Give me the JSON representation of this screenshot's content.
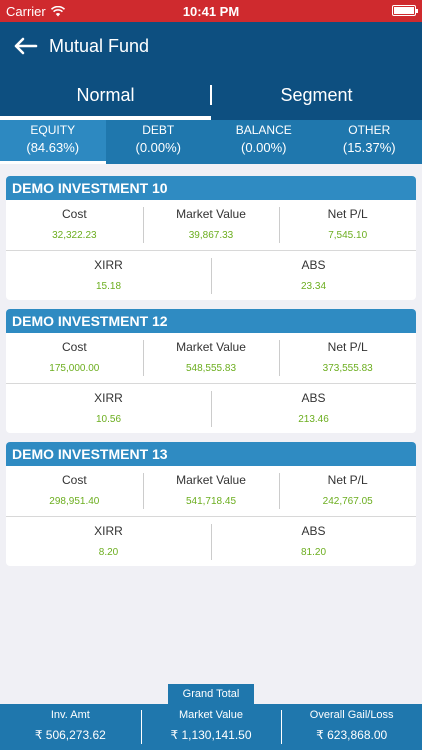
{
  "status": {
    "carrier": "Carrier",
    "time": "10:41 PM"
  },
  "nav": {
    "title": "Mutual Fund"
  },
  "segments": [
    {
      "label": "Normal",
      "active": true
    },
    {
      "label": "Segment",
      "active": false
    }
  ],
  "categories": [
    {
      "label": "EQUITY",
      "pct": "(84.63%)",
      "active": true
    },
    {
      "label": "DEBT",
      "pct": "(0.00%)",
      "active": false
    },
    {
      "label": "BALANCE",
      "pct": "(0.00%)",
      "active": false
    },
    {
      "label": "OTHER",
      "pct": "(15.37%)",
      "active": false
    }
  ],
  "labels": {
    "cost": "Cost",
    "market_value": "Market Value",
    "net_pl": "Net P/L",
    "xirr": "XIRR",
    "abs": "ABS"
  },
  "investments": [
    {
      "name": "DEMO INVESTMENT 10",
      "cost": "32,322.23",
      "market_value": "39,867.33",
      "net_pl": "7,545.10",
      "xirr": "15.18",
      "abs": "23.34"
    },
    {
      "name": "DEMO INVESTMENT 12",
      "cost": "175,000.00",
      "market_value": "548,555.83",
      "net_pl": "373,555.83",
      "xirr": "10.56",
      "abs": "213.46"
    },
    {
      "name": "DEMO INVESTMENT 13",
      "cost": "298,951.40",
      "market_value": "541,718.45",
      "net_pl": "242,767.05",
      "xirr": "8.20",
      "abs": "81.20"
    }
  ],
  "grand_total": {
    "title": "Grand Total",
    "inv_amt_label": "Inv. Amt",
    "inv_amt": "₹ 506,273.62",
    "market_value_label": "Market Value",
    "market_value": "₹ 1,130,141.50",
    "overall_label": "Overall Gail/Loss",
    "overall": "₹ 623,868.00"
  },
  "colors": {
    "status_bar": "#cf2a2e",
    "nav": "#0d4f80",
    "accent": "#1f77ad",
    "value_green": "#6cae1f"
  }
}
